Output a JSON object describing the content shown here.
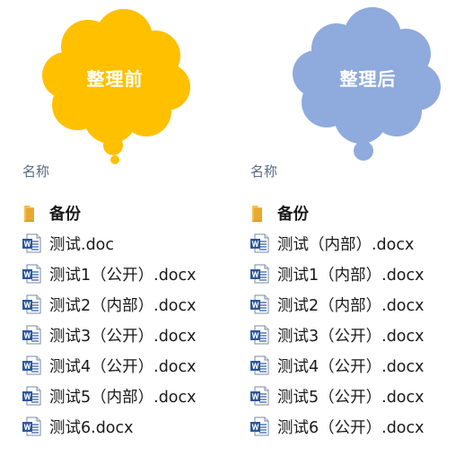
{
  "clouds": {
    "before": {
      "label": "整理前",
      "color": "#FFC000"
    },
    "after": {
      "label": "整理后",
      "color": "#8FAADC"
    }
  },
  "panels": {
    "before": {
      "column_header": "名称",
      "items": [
        {
          "name": "备份",
          "type": "folder"
        },
        {
          "name": "测试.doc",
          "type": "word-doc"
        },
        {
          "name": "测试1（公开）.docx",
          "type": "word-doc"
        },
        {
          "name": "测试2（内部）.docx",
          "type": "word-doc"
        },
        {
          "name": "测试3（公开）.docx",
          "type": "word-doc"
        },
        {
          "name": "测试4（公开）.docx",
          "type": "word-doc"
        },
        {
          "name": "测试5（内部）.docx",
          "type": "word-doc"
        },
        {
          "name": "测试6.docx",
          "type": "word-doc"
        }
      ]
    },
    "after": {
      "column_header": "名称",
      "items": [
        {
          "name": "备份",
          "type": "folder"
        },
        {
          "name": "测试（内部）.docx",
          "type": "word-doc"
        },
        {
          "name": "测试1（内部）.docx",
          "type": "word-doc"
        },
        {
          "name": "测试2（内部）.docx",
          "type": "word-doc"
        },
        {
          "name": "测试3（公开）.docx",
          "type": "word-doc"
        },
        {
          "name": "测试4（公开）.docx",
          "type": "word-doc"
        },
        {
          "name": "测试5（公开）.docx",
          "type": "word-doc"
        },
        {
          "name": "测试6（公开）.docx",
          "type": "word-doc"
        }
      ]
    }
  },
  "icons": {
    "folder": "folder-icon",
    "word-doc": "word-document-icon",
    "folder_color": "#F5C04A",
    "word_color": "#2B579A"
  }
}
